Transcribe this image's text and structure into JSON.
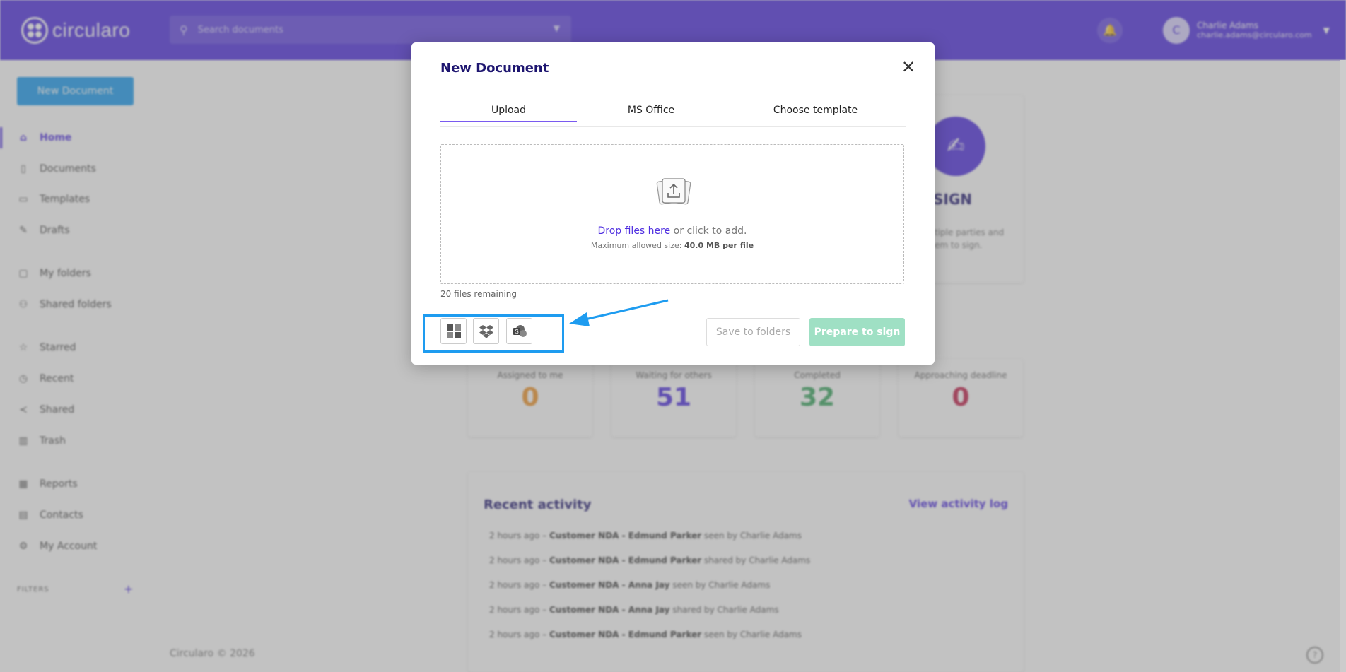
{
  "app": {
    "logo_text": "circularo",
    "search_placeholder": "Search documents",
    "user_initial": "C",
    "user_name": "Charlie Adams",
    "user_email": "charlie.adams@circularo.com",
    "footer": "Circularo © 2026"
  },
  "sidebar": {
    "new_document": "New Document",
    "items": [
      {
        "label": "Home",
        "icon": "home-icon"
      },
      {
        "label": "Documents",
        "icon": "document-icon"
      },
      {
        "label": "Templates",
        "icon": "template-icon"
      },
      {
        "label": "Drafts",
        "icon": "edit-icon"
      },
      {
        "label": "My folders",
        "icon": "folder-icon"
      },
      {
        "label": "Shared folders",
        "icon": "shared-folder-icon"
      },
      {
        "label": "Starred",
        "icon": "star-icon"
      },
      {
        "label": "Recent",
        "icon": "clock-icon"
      },
      {
        "label": "Shared",
        "icon": "share-icon"
      },
      {
        "label": "Trash",
        "icon": "trash-icon"
      },
      {
        "label": "Reports",
        "icon": "chart-icon"
      },
      {
        "label": "Contacts",
        "icon": "contacts-icon"
      },
      {
        "label": "My Account",
        "icon": "gear-icon"
      }
    ],
    "filters_label": "FILTERS",
    "filters_add": "+"
  },
  "dashboard": {
    "sign_card": {
      "title": "SIGN",
      "description": "…tiple parties and …em to sign."
    },
    "stats": [
      {
        "label": "Assigned to me",
        "value": "0",
        "color": "#f0952a"
      },
      {
        "label": "Waiting for others",
        "value": "51",
        "color": "#4f2fe0"
      },
      {
        "label": "Completed",
        "value": "32",
        "color": "#3aa660"
      },
      {
        "label": "Approaching deadline",
        "value": "0",
        "color": "#c21f4a"
      }
    ],
    "activity": {
      "title": "Recent activity",
      "link": "View activity log",
      "rows": [
        {
          "time": "2 hours ago",
          "doc": "Customer NDA - Edmund Parker",
          "action": "seen by Charlie Adams"
        },
        {
          "time": "2 hours ago",
          "doc": "Customer NDA - Edmund Parker",
          "action": "shared by Charlie Adams"
        },
        {
          "time": "2 hours ago",
          "doc": "Customer NDA - Anna Jay",
          "action": "seen by Charlie Adams"
        },
        {
          "time": "2 hours ago",
          "doc": "Customer NDA - Anna Jay",
          "action": "shared by Charlie Adams"
        },
        {
          "time": "2 hours ago",
          "doc": "Customer NDA - Edmund Parker",
          "action": "seen by Charlie Adams"
        }
      ]
    }
  },
  "modal": {
    "title": "New Document",
    "tabs": [
      {
        "label": "Upload",
        "active": true
      },
      {
        "label": "MS Office",
        "active": false
      },
      {
        "label": "Choose template",
        "active": false
      }
    ],
    "drop_link": "Drop files here",
    "drop_rest": " or click to add.",
    "max_size_label": "Maximum allowed size: ",
    "max_size_value": "40.0 MB per file",
    "remaining": "20 files remaining",
    "sources": [
      {
        "name": "windows-icon"
      },
      {
        "name": "dropbox-icon"
      },
      {
        "name": "sharepoint-icon"
      }
    ],
    "save_button": "Save to folders",
    "prepare_button": "Prepare to sign"
  },
  "colors": {
    "brand": "#4f2fe0",
    "accent_blue": "#1e9cf0",
    "prepare_disabled": "#9fe0c4"
  }
}
